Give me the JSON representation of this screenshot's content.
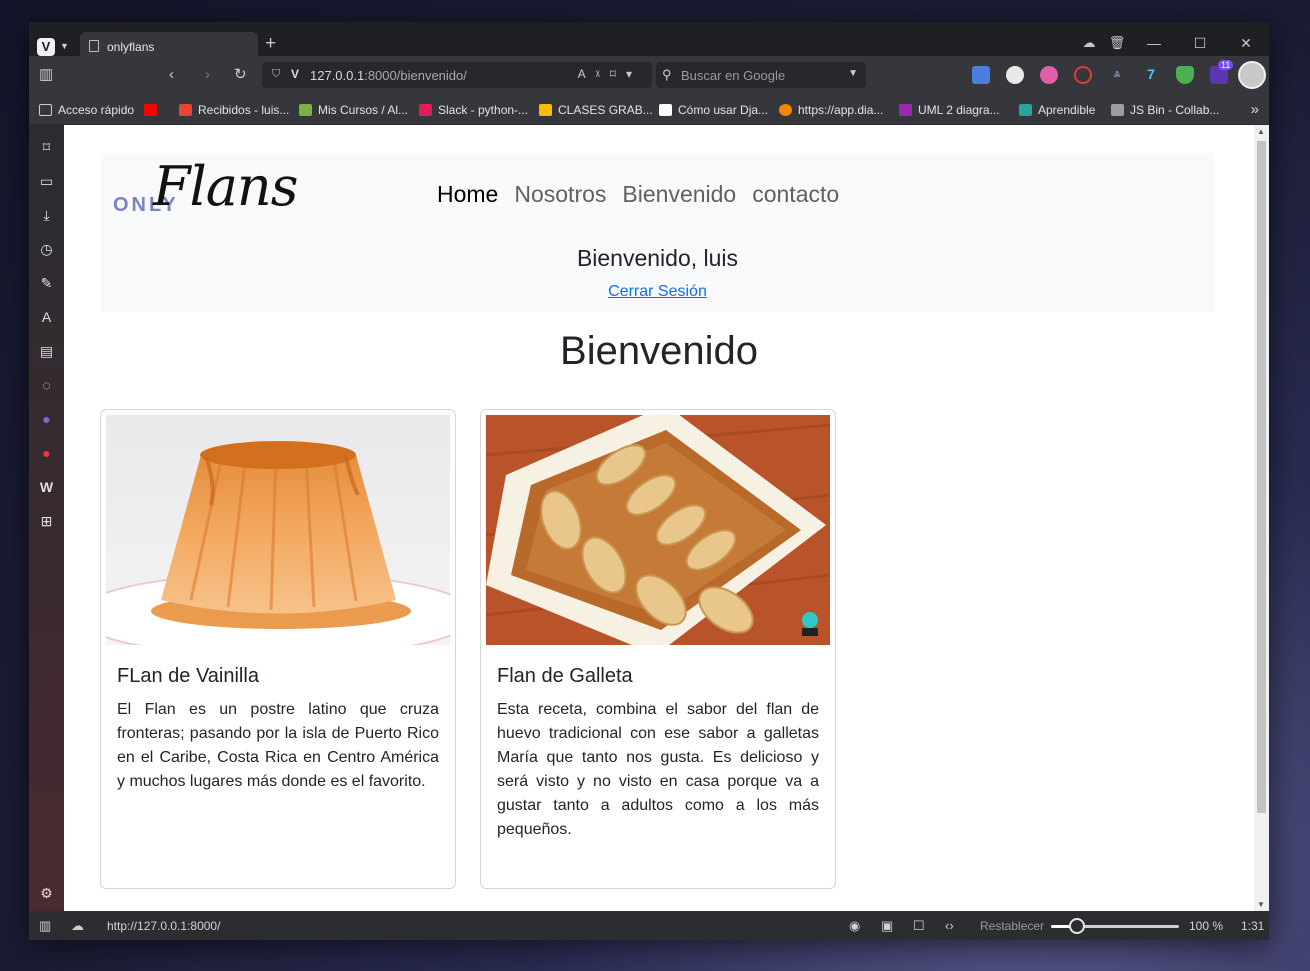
{
  "browser": {
    "tab_title": "onlyflans",
    "url_host": "127.0.0.1",
    "url_rest": ":8000/bienvenido/",
    "search_placeholder": "Buscar en Google",
    "notification_badge": "11"
  },
  "bookmarks": [
    {
      "label": "Acceso rápido",
      "color": "#d0d0d0"
    },
    {
      "label": "",
      "color": "#ff0000"
    },
    {
      "label": "Recibidos - luis...",
      "color": "#ea4335"
    },
    {
      "label": "Mis Cursos / Al...",
      "color": "#7cb342"
    },
    {
      "label": "Slack - python-...",
      "color": "#e01e5a"
    },
    {
      "label": "CLASES GRAB...",
      "color": "#fbbc04"
    },
    {
      "label": "Cómo usar Dja...",
      "color": "#ffffff"
    },
    {
      "label": "https://app.dia...",
      "color": "#f08705"
    },
    {
      "label": "UML 2 diagra...",
      "color": "#9c27b0"
    },
    {
      "label": "Aprendible",
      "color": "#26a69a"
    },
    {
      "label": "JS Bin - Collab...",
      "color": "#9e9e9e"
    }
  ],
  "site": {
    "brand_small": "ONLY",
    "brand_script": "Flans",
    "nav": [
      "Home",
      "Nosotros",
      "Bienvenido",
      "contacto"
    ],
    "active_nav": "Home",
    "welcome": "Bienvenido, luis",
    "logout": "Cerrar Sesión",
    "heading": "Bienvenido",
    "cards": [
      {
        "title": "FLan de Vainilla",
        "text": "El Flan es un postre latino que cruza fronteras; pasando por la isla de Puerto Rico en el Caribe, Costa Rica en Centro América y muchos lugares más donde es el favorito."
      },
      {
        "title": "Flan de Galleta",
        "text": "Esta receta, combina el sabor del flan de huevo tradicional con ese sabor a galletas María que tanto nos gusta. Es delicioso y será visto y no visto en casa porque va a gustar tanto a adultos como a los más pequeños."
      }
    ]
  },
  "statusbar": {
    "link_preview": "http://127.0.0.1:8000/",
    "reset_label": "Restablecer",
    "zoom": "100 %",
    "zoom_level": 0.2,
    "time": "1:31"
  }
}
